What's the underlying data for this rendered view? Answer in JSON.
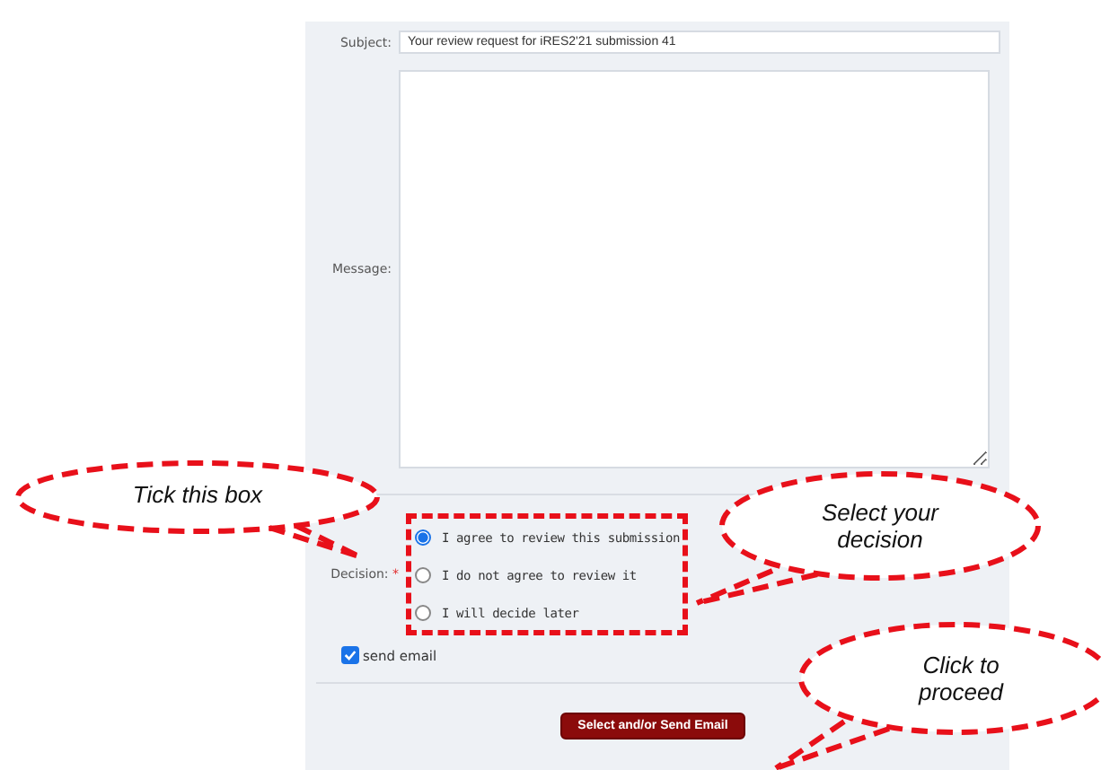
{
  "form": {
    "subject_label": "Subject:",
    "subject_value": "Your review request for iRES2'21 submission 41",
    "message_label": "Message:",
    "decision_label": "Decision:",
    "required_mark": "*",
    "decision_options": [
      {
        "label": "I agree to review this submission",
        "selected": true
      },
      {
        "label": "I do not agree to review it",
        "selected": false
      },
      {
        "label": "I will decide later",
        "selected": false
      }
    ],
    "send_email": {
      "label": "send email",
      "checked": true
    },
    "submit_button": "Select and/or Send Email"
  },
  "callouts": [
    {
      "text": "Tick this box"
    },
    {
      "text": "Select your decision"
    },
    {
      "text": "Click to proceed"
    }
  ]
}
